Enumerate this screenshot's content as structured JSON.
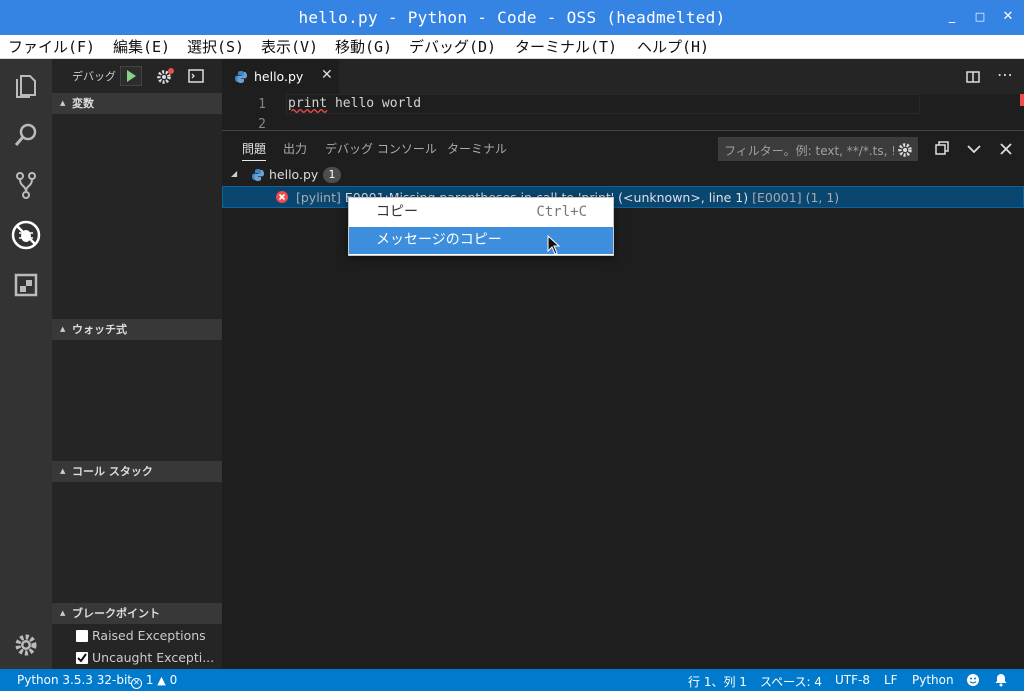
{
  "window": {
    "title": "hello.py - Python - Code - OSS (headmelted)",
    "minimize": "_",
    "maximize": "□",
    "close": "✕"
  },
  "menu": [
    "ファイル(F)",
    "編集(E)",
    "選択(S)",
    "表示(V)",
    "移動(G)",
    "デバッグ(D)",
    "ターミナル(T)",
    "ヘルプ(H)"
  ],
  "sidebar": {
    "debug_label": "デバッグ",
    "sections": {
      "variables": "変数",
      "watch": "ウォッチ式",
      "callstack": "コール スタック",
      "breakpoints": "ブレークポイント"
    },
    "breakpoints": [
      {
        "label": "Raised Exceptions",
        "checked": false
      },
      {
        "label": "Uncaught Excepti...",
        "checked": true
      }
    ]
  },
  "editor": {
    "tab": {
      "name": "hello.py"
    },
    "lines": [
      {
        "number": "1",
        "keyword": "print",
        "rest": " hello world"
      },
      {
        "number": "2"
      }
    ]
  },
  "panel": {
    "tabs": [
      "問題",
      "出力",
      "デバッグ コンソール",
      "ターミナル"
    ],
    "filter_placeholder": "フィルター。例: text, **/*.ts, !**/node_modules/**",
    "file": {
      "name": "hello.py",
      "count": "1"
    },
    "error": {
      "source": "[pylint]",
      "message": "E0001:Missing parentheses in call to 'print' (<unknown>, line 1)",
      "code": "[E0001]",
      "position": "(1, 1)"
    }
  },
  "context_menu": [
    {
      "label": "コピー",
      "shortcut": "Ctrl+C",
      "highlighted": false
    },
    {
      "label": "メッセージのコピー",
      "shortcut": "",
      "highlighted": true
    }
  ],
  "statusbar": {
    "interpreter": "Python 3.5.3 32-bit",
    "errors": "1",
    "warnings": "0",
    "position": "行 1、列 1",
    "spaces": "スペース: 4",
    "encoding": "UTF-8",
    "eol": "LF",
    "language": "Python"
  },
  "colors": {
    "titlebar": "#3584e4",
    "statusbar": "#007acc",
    "selection": "#094771",
    "menu_highlight": "#3e8ede",
    "error": "#f14c4c"
  }
}
